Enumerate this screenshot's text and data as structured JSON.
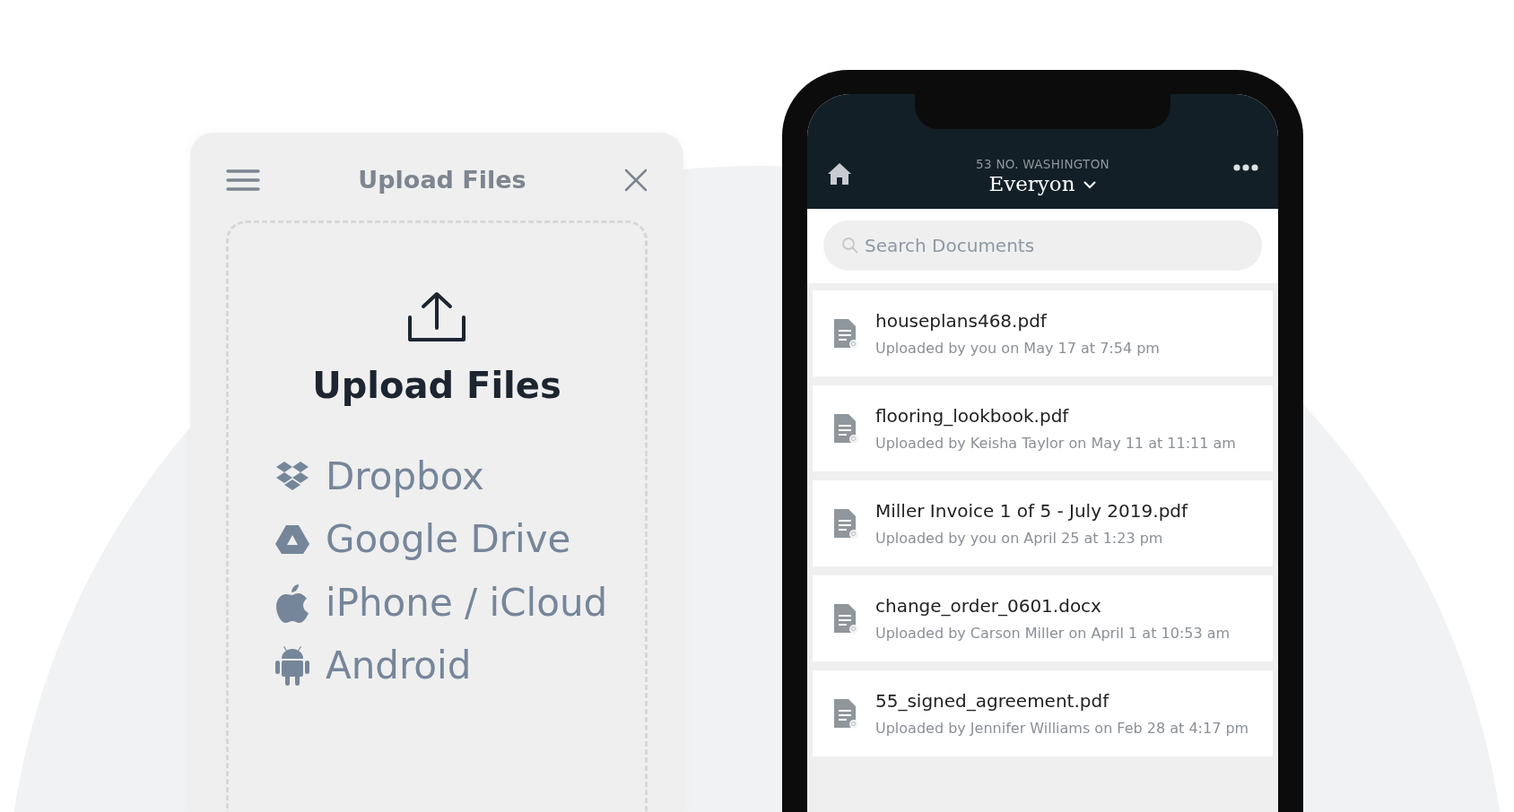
{
  "upload_panel": {
    "title": "Upload Files",
    "dropzone": {
      "heading": "Upload Files",
      "sources": [
        {
          "kind": "dropbox",
          "label": "Dropbox"
        },
        {
          "kind": "drive",
          "label": "Google Drive"
        },
        {
          "kind": "apple",
          "label": "iPhone / iCloud"
        },
        {
          "kind": "android",
          "label": "Android"
        }
      ]
    }
  },
  "phone": {
    "header": {
      "subtitle": "53 NO. WASHINGTON",
      "project": "Everyon"
    },
    "search": {
      "placeholder": "Search Documents"
    },
    "documents": [
      {
        "name": "houseplans468.pdf",
        "uploaded_by": "Uploaded by you on May 17 at 7:54 pm"
      },
      {
        "name": "flooring_lookbook.pdf",
        "uploaded_by": "Uploaded by Keisha Taylor on May 11 at 11:11 am"
      },
      {
        "name": "Miller Invoice 1 of 5 - July 2019.pdf",
        "uploaded_by": "Uploaded by you on April 25 at 1:23 pm"
      },
      {
        "name": "change_order_0601.docx",
        "uploaded_by": "Uploaded by Carson Miller on April 1 at 10:53 am"
      },
      {
        "name": "55_signed_agreement.pdf",
        "uploaded_by": "Uploaded by Jennifer Williams on Feb 28 at 4:17 pm"
      }
    ]
  }
}
